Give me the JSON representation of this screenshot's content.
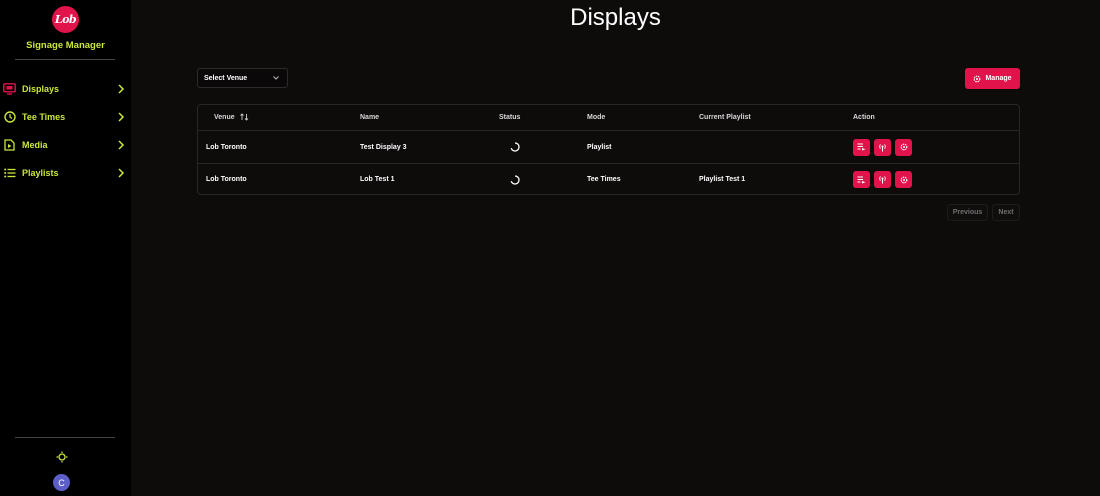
{
  "sidebar": {
    "logo_text": "Lob",
    "brand": "Signage Manager",
    "items": [
      {
        "label": "Displays",
        "icon": "monitor-icon",
        "active": true
      },
      {
        "label": "Tee Times",
        "icon": "clock-icon"
      },
      {
        "label": "Media",
        "icon": "media-file-icon"
      },
      {
        "label": "Playlists",
        "icon": "list-icon"
      }
    ],
    "avatar_initial": "C"
  },
  "page": {
    "title": "Displays"
  },
  "toolbar": {
    "venue_select": "Select Venue",
    "manage_label": "Manage"
  },
  "table": {
    "columns": [
      "Venue",
      "Name",
      "Status",
      "Mode",
      "Current Playlist",
      "Action"
    ],
    "rows": [
      {
        "venue": "Lob Toronto",
        "name": "Test Display 3",
        "status": "loading",
        "mode": "Playlist",
        "playlist": ""
      },
      {
        "venue": "Lob Toronto",
        "name": "Lob Test 1",
        "status": "loading",
        "mode": "Tee Times",
        "playlist": "Playlist Test 1"
      }
    ]
  },
  "pagination": {
    "previous": "Previous",
    "next": "Next"
  },
  "colors": {
    "accent": "#e0134b",
    "nav_text": "#c9e83a",
    "background": "#0e0b0b",
    "sidebar": "#000000"
  }
}
